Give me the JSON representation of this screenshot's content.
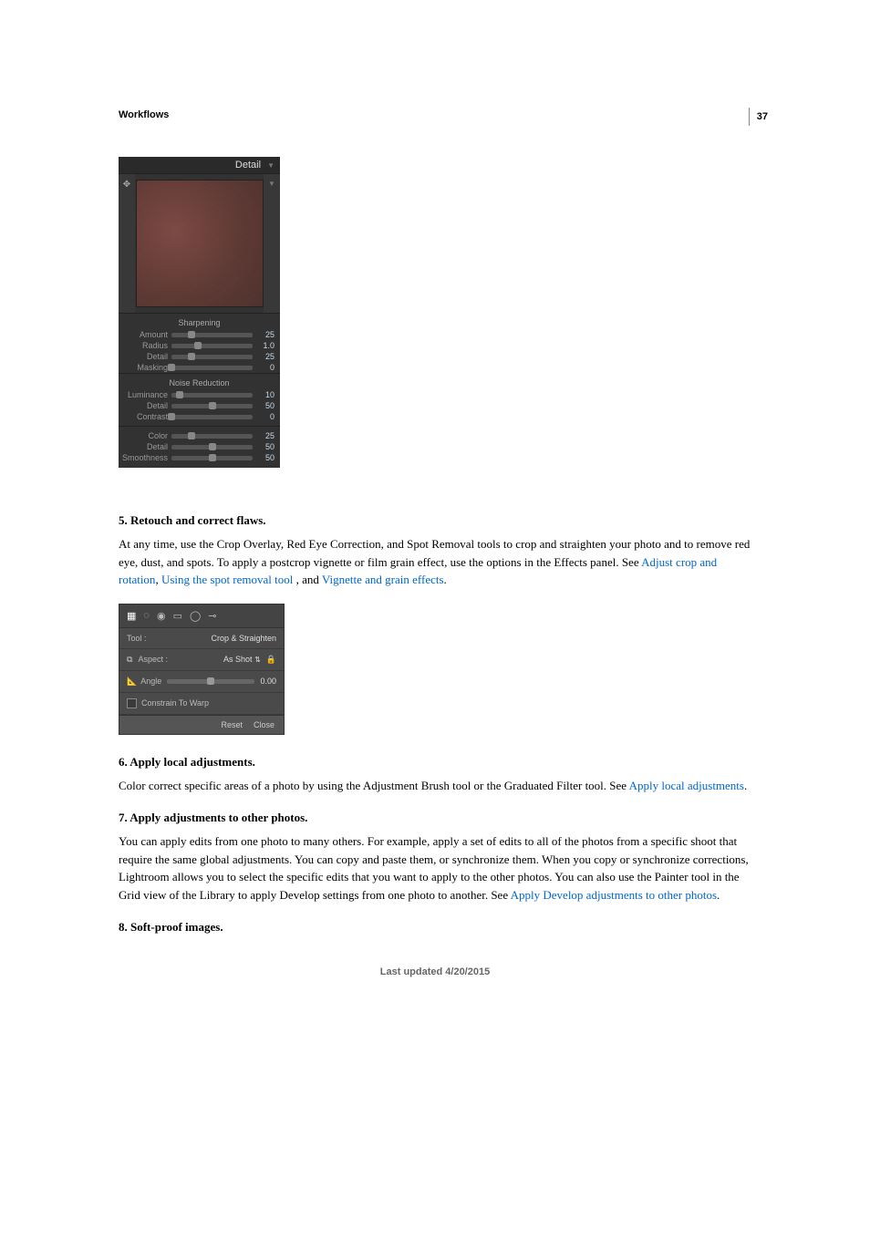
{
  "page_number": "37",
  "section": "Workflows",
  "footer": "Last updated 4/20/2015",
  "detail_panel": {
    "title": "Detail",
    "sections": {
      "sharpening": {
        "heading": "Sharpening",
        "rows": [
          {
            "label": "Amount",
            "value": "25",
            "pct": 25
          },
          {
            "label": "Radius",
            "value": "1.0",
            "pct": 33
          },
          {
            "label": "Detail",
            "value": "25",
            "pct": 25
          },
          {
            "label": "Masking",
            "value": "0",
            "pct": 0
          }
        ]
      },
      "noise": {
        "heading": "Noise Reduction",
        "rows": [
          {
            "label": "Luminance",
            "value": "10",
            "pct": 10
          },
          {
            "label": "Detail",
            "value": "50",
            "pct": 50
          },
          {
            "label": "Contrast",
            "value": "0",
            "pct": 0
          }
        ],
        "rows2": [
          {
            "label": "Color",
            "value": "25",
            "pct": 25
          },
          {
            "label": "Detail",
            "value": "50",
            "pct": 50
          },
          {
            "label": "Smoothness",
            "value": "50",
            "pct": 50
          }
        ]
      }
    }
  },
  "step5": {
    "heading": "5. Retouch and correct flaws.",
    "body_a": "At any time, use the Crop Overlay, Red Eye Correction, and Spot Removal tools to crop and straighten your photo and to remove red eye, dust, and spots. To apply a postcrop vignette or film grain effect, use the options in the Effects panel. See ",
    "link1": "Adjust crop and rotation",
    "sep1": ", ",
    "link2": "Using the spot removal tool",
    "sep2": " , and ",
    "link3": "Vignette and grain effects",
    "end": "."
  },
  "crop_panel": {
    "tool_label": "Tool :",
    "tool_value": "Crop & Straighten",
    "aspect_label": "Aspect :",
    "aspect_value": "As Shot",
    "angle_label": "Angle",
    "angle_value": "0.00",
    "constrain": "Constrain To Warp",
    "reset": "Reset",
    "close": "Close"
  },
  "step6": {
    "heading": "6. Apply local adjustments.",
    "body_a": "Color correct specific areas of a photo by using the Adjustment Brush tool or the Graduated Filter tool. See ",
    "link": "Apply local adjustments",
    "end": "."
  },
  "step7": {
    "heading": "7. Apply adjustments to other photos.",
    "body_a": "You can apply edits from one photo to many others. For example, apply a set of edits to all of the photos from a specific shoot that require the same global adjustments. You can copy and paste them, or synchronize them. When you copy or synchronize corrections, Lightroom allows you to select the specific edits that you want to apply to the other photos. You can also use the Painter tool in the Grid view of the Library to apply Develop settings from one photo to another. See ",
    "link": "Apply Develop adjustments to other photos",
    "end": "."
  },
  "step8": {
    "heading": "8. Soft-proof images."
  }
}
